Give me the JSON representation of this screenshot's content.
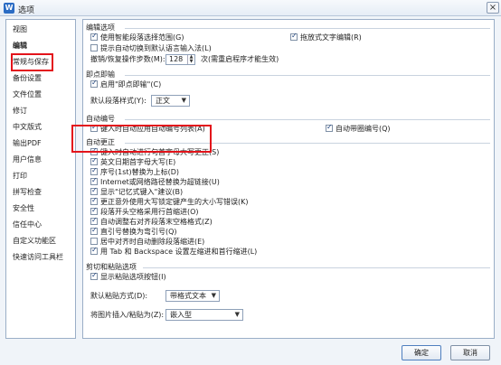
{
  "window": {
    "title": "选项",
    "app_icon_letter": "W",
    "close_glyph": "×"
  },
  "sidebar": {
    "items": [
      {
        "label": "视图"
      },
      {
        "label": "编辑"
      },
      {
        "label": "常规与保存"
      },
      {
        "label": "备份设置"
      },
      {
        "label": "文件位置"
      },
      {
        "label": "修订"
      },
      {
        "label": "中文版式"
      },
      {
        "label": "输出PDF"
      },
      {
        "label": "用户信息"
      },
      {
        "label": "打印"
      },
      {
        "label": "拼写检查"
      },
      {
        "label": "安全性"
      },
      {
        "label": "信任中心"
      },
      {
        "label": "自定义功能区"
      },
      {
        "label": "快速访问工具栏"
      }
    ],
    "selected": "编辑"
  },
  "edit_options": {
    "title": "编辑选项",
    "smart_select": {
      "label": "使用智能段落选择范围(G)",
      "checked": true
    },
    "drag_drop": {
      "label": "拖放式文字编辑(R)",
      "checked": true
    },
    "ime_switch": {
      "label": "提示自动切换到默认语言输入法(L)",
      "checked": false
    },
    "undo_steps": {
      "label": "撤销/恢复操作步数(M):",
      "value": "128",
      "note": "次(需重启程序才能生效)"
    }
  },
  "click_type": {
    "title": "即点即输",
    "enable": {
      "label": "启用\"即点即输\"(C)",
      "checked": true
    },
    "default_style": {
      "label": "默认段落样式(Y):",
      "value": "正文"
    }
  },
  "auto_numbering": {
    "title": "自动编号",
    "auto_list": {
      "label": "键入时自动应用自动编号列表(A)",
      "checked": true
    },
    "auto_bullet": {
      "label": "自动带圈编号(Q)",
      "checked": true
    }
  },
  "auto_correct": {
    "title": "自动更正",
    "items": [
      {
        "label": "键入时自动进行句首字母大写更正(S)",
        "checked": true
      },
      {
        "label": "英文日期首字母大写(E)",
        "checked": true
      },
      {
        "label": "序号(1st)替换为上标(D)",
        "checked": true
      },
      {
        "label": "Internet或网络路径替换为超链接(U)",
        "checked": true
      },
      {
        "label": "显示\"记忆式键入\"建议(B)",
        "checked": true
      },
      {
        "label": "更正意外使用大写锁定键产生的大小写错误(K)",
        "checked": true
      },
      {
        "label": "段落开头空格采用行首缩进(O)",
        "checked": true
      },
      {
        "label": "自动调整右对齐段落末空格格式(Z)",
        "checked": true
      },
      {
        "label": "直引号替换为弯引号(Q)",
        "checked": true
      },
      {
        "label": "居中对齐时自动删除段落缩进(E)",
        "checked": false
      },
      {
        "label": "用 Tab 和 Backspace 设置左缩进和首行缩进(L)",
        "checked": true
      }
    ]
  },
  "cut_paste": {
    "title": "剪切和粘贴选项",
    "show_paste_btn": {
      "label": "显示粘贴选项按钮(I)",
      "checked": true
    },
    "default_paste": {
      "label": "默认粘贴方式(D):",
      "value": "带格式文本"
    },
    "image_insert": {
      "label": "将图片插入/粘贴为(Z):",
      "value": "嵌入型"
    }
  },
  "buttons": {
    "ok": "确定",
    "cancel": "取消"
  }
}
